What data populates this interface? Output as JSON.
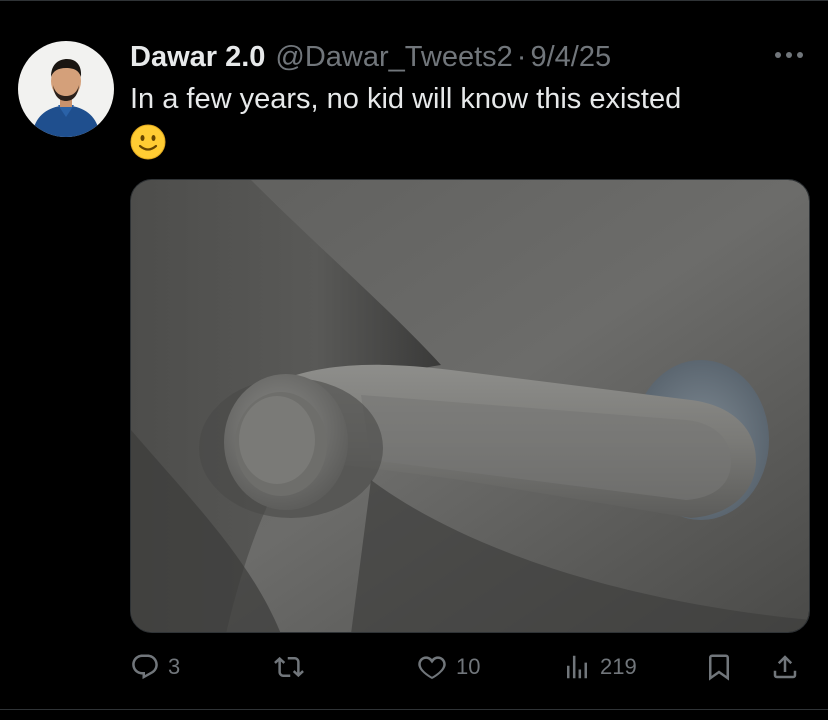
{
  "author": {
    "display_name": "Dawar 2.0",
    "handle": "@Dawar_Tweets2",
    "separator": "·",
    "date": "9/4/25",
    "avatar_icon": "avatar-photo"
  },
  "tweet": {
    "text": "In a few years, no kid will know this existed",
    "emoji": "slightly-smiling-face"
  },
  "media": {
    "subject": "car-window-crank-handle"
  },
  "actions": {
    "replies": "3",
    "retweets": "",
    "likes": "10",
    "views": "219"
  },
  "colors": {
    "background": "#000000",
    "text": "#e7e9ea",
    "muted": "#71767b",
    "divider": "#2f3336"
  }
}
